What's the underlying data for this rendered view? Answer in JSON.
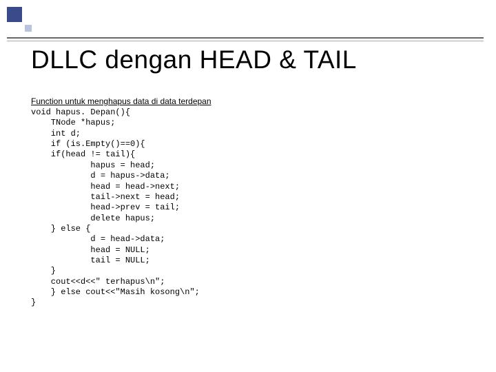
{
  "slide": {
    "title": "DLLC dengan HEAD & TAIL",
    "subheading": "Function untuk menghapus data di data terdepan",
    "code": "void hapus. Depan(){\n    TNode *hapus;\n    int d;\n    if (is.Empty()==0){\n    if(head != tail){\n            hapus = head;\n            d = hapus->data;\n            head = head->next;\n            tail->next = head;\n            head->prev = tail;\n            delete hapus;\n    } else {\n            d = head->data;\n            head = NULL;\n            tail = NULL;\n    }\n    cout<<d<<\" terhapus\\n\";\n    } else cout<<\"Masih kosong\\n\";\n}"
  }
}
